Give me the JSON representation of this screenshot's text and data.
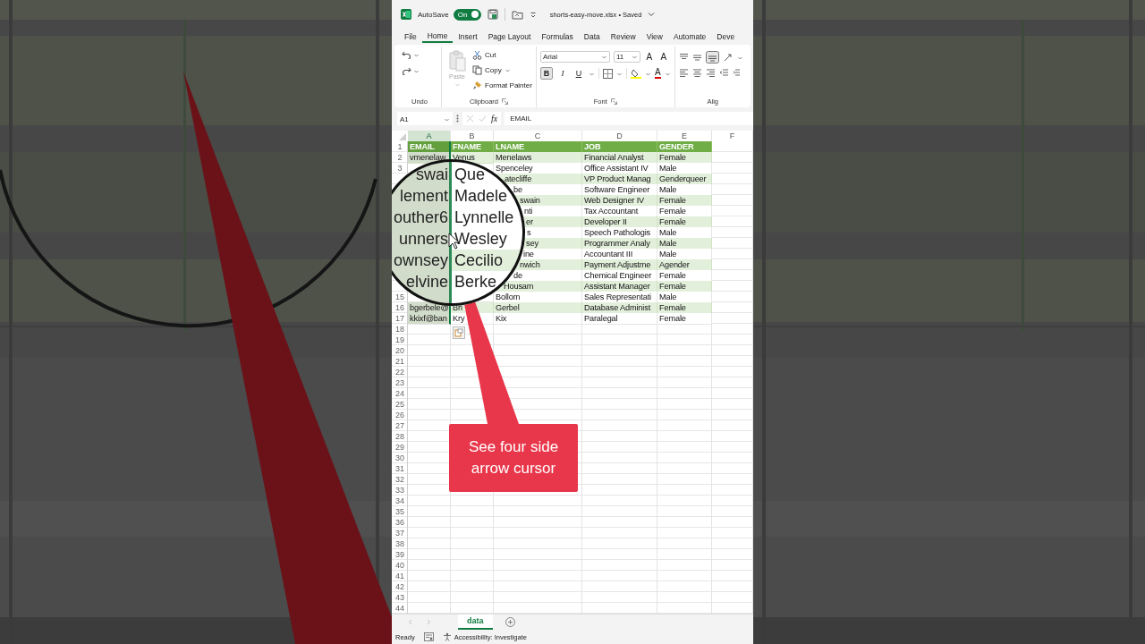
{
  "title_bar": {
    "autosave_label": "AutoSave",
    "autosave": {
      "on": true,
      "label": "On"
    },
    "file_title": "shorts-easy-move.xlsx • Saved"
  },
  "tabs": [
    {
      "label": "File",
      "selected": false
    },
    {
      "label": "Home",
      "selected": true
    },
    {
      "label": "Insert",
      "selected": false
    },
    {
      "label": "Page Layout",
      "selected": false
    },
    {
      "label": "Formulas",
      "selected": false
    },
    {
      "label": "Data",
      "selected": false
    },
    {
      "label": "Review",
      "selected": false
    },
    {
      "label": "View",
      "selected": false
    },
    {
      "label": "Automate",
      "selected": false
    },
    {
      "label": "Deve",
      "selected": false
    }
  ],
  "ribbon": {
    "groups": [
      {
        "kind": "undo",
        "label": "Undo"
      },
      {
        "kind": "clipboard",
        "label": "Clipboard",
        "paste": {
          "label": "Paste",
          "disabled": true
        },
        "items": [
          "Cut",
          "Copy",
          "Format Painter"
        ]
      },
      {
        "kind": "font",
        "label": "Font",
        "font_name": "Arial",
        "font_size": "11",
        "size_buttons": [
          "A",
          "A"
        ],
        "format_buttons": [
          {
            "label": "B",
            "selected": true
          },
          {
            "label": "I",
            "selected": false
          },
          {
            "label": "U",
            "selected": false
          }
        ],
        "font_color_label": "A"
      },
      {
        "kind": "alignment",
        "label": "Alig"
      }
    ]
  },
  "formula_bar": {
    "name_box": "A1",
    "fx": "fx",
    "value": "EMAIL"
  },
  "columns": [
    {
      "label": "A",
      "selected": true
    },
    {
      "label": "B",
      "selected": false
    },
    {
      "label": "C",
      "selected": false
    },
    {
      "label": "D",
      "selected": false
    },
    {
      "label": "E",
      "selected": false
    },
    {
      "label": "F",
      "selected": false
    }
  ],
  "rows": [
    {
      "number": "1",
      "kind": "header",
      "cells": {
        "a": "EMAIL",
        "b": "FNAME",
        "c": "LNAME",
        "d": "JOB",
        "e": "GENDER"
      }
    },
    {
      "number": "2",
      "kind": "data",
      "shaded": true,
      "cells": {
        "a": "vmenelaw",
        "b": "Venus",
        "c": "Menelaws",
        "d": "Financial Analyst",
        "e": "Female"
      }
    },
    {
      "number": "3",
      "kind": "data",
      "shaded": false,
      "cells": {
        "c": "Spenceley",
        "d": "Office Assistant IV",
        "e": "Male"
      }
    },
    {
      "kind": "data",
      "shaded": true,
      "cells": {
        "c": "atecliffe",
        "d": "VP Product Manag",
        "e": "Genderqueer"
      }
    },
    {
      "kind": "data",
      "shaded": false,
      "cells": {
        "c": "be",
        "d": "Software Engineer",
        "e": "Male"
      }
    },
    {
      "kind": "data",
      "shaded": true,
      "cells": {
        "c": "swain",
        "d": "Web Designer IV",
        "e": "Female"
      }
    },
    {
      "kind": "data",
      "shaded": false,
      "cells": {
        "c": "nti",
        "d": "Tax Accountant",
        "e": "Female"
      }
    },
    {
      "kind": "data",
      "shaded": true,
      "cells": {
        "c": "er",
        "d": "Developer II",
        "e": "Female"
      }
    },
    {
      "kind": "data",
      "shaded": false,
      "cells": {
        "c": "s",
        "d": "Speech Pathologis",
        "e": "Male"
      }
    },
    {
      "kind": "data",
      "shaded": true,
      "cells": {
        "c": "sey",
        "d": "Programmer Analy",
        "e": "Male"
      }
    },
    {
      "kind": "data",
      "shaded": false,
      "cells": {
        "c": "ine",
        "d": "Accountant III",
        "e": "Male"
      }
    },
    {
      "kind": "data",
      "shaded": true,
      "cells": {
        "c": "nwich",
        "d": "Payment Adjustme",
        "e": "Agender"
      }
    },
    {
      "kind": "data",
      "shaded": false,
      "cells": {
        "c": "de",
        "d": "Chemical Engineer",
        "e": "Female"
      }
    },
    {
      "kind": "data",
      "shaded": true,
      "cells": {
        "c": "Housam",
        "d": "Assistant Manager",
        "e": "Female"
      }
    },
    {
      "number": "15",
      "kind": "data",
      "shaded": false,
      "cells": {
        "c": "Bollom",
        "d": "Sales Representati",
        "e": "Male"
      }
    },
    {
      "number": "16",
      "kind": "data",
      "shaded": true,
      "cells": {
        "a": "bgerbele@",
        "b": "Bri",
        "c": "Gerbel",
        "d": "Database Administ",
        "e": "Female"
      }
    },
    {
      "number": "17",
      "kind": "data",
      "shaded": false,
      "cells": {
        "a": "kkixf@ban",
        "b": "Kry",
        "c": "Kix",
        "d": "Paralegal",
        "e": "Female"
      }
    },
    {
      "number": "18",
      "kind": "empty"
    },
    {
      "number": "19",
      "kind": "empty"
    },
    {
      "number": "20",
      "kind": "empty"
    },
    {
      "number": "21",
      "kind": "empty"
    },
    {
      "number": "22",
      "kind": "empty"
    },
    {
      "number": "23",
      "kind": "empty"
    },
    {
      "number": "24",
      "kind": "empty"
    },
    {
      "number": "25",
      "kind": "empty"
    },
    {
      "number": "26",
      "kind": "empty"
    },
    {
      "number": "27",
      "kind": "empty"
    },
    {
      "number": "28",
      "kind": "empty"
    },
    {
      "number": "29",
      "kind": "empty"
    },
    {
      "number": "30",
      "kind": "empty"
    },
    {
      "number": "31",
      "kind": "empty"
    },
    {
      "number": "32",
      "kind": "empty"
    },
    {
      "number": "33",
      "kind": "empty"
    },
    {
      "number": "34",
      "kind": "empty"
    },
    {
      "number": "35",
      "kind": "empty"
    },
    {
      "number": "36",
      "kind": "empty"
    },
    {
      "number": "37",
      "kind": "empty"
    },
    {
      "number": "38",
      "kind": "empty"
    },
    {
      "number": "39",
      "kind": "empty"
    },
    {
      "number": "40",
      "kind": "empty"
    },
    {
      "number": "41",
      "kind": "empty"
    },
    {
      "number": "42",
      "kind": "empty"
    },
    {
      "number": "43",
      "kind": "empty"
    },
    {
      "number": "44",
      "kind": "empty"
    }
  ],
  "magnifier": {
    "rows": [
      {
        "a": "swai",
        "b": "Que",
        "shaded": false
      },
      {
        "a": "lement",
        "b": "Madele",
        "shaded": false
      },
      {
        "a": "outher6",
        "b": "Lynnelle",
        "shaded": false
      },
      {
        "a": "unners",
        "b": "Wesley",
        "shaded": false
      },
      {
        "a": "ownsey",
        "b": "Cecilio",
        "shaded": true
      },
      {
        "a": "elvine",
        "b": "Berke",
        "shaded": false
      }
    ]
  },
  "callout": {
    "text": "See four side arrow cursor"
  },
  "sheet_tabs": [
    {
      "label": "data",
      "selected": true
    }
  ],
  "status_bar": {
    "status": "Ready",
    "accessibility": "Accessibility: Investigate"
  }
}
